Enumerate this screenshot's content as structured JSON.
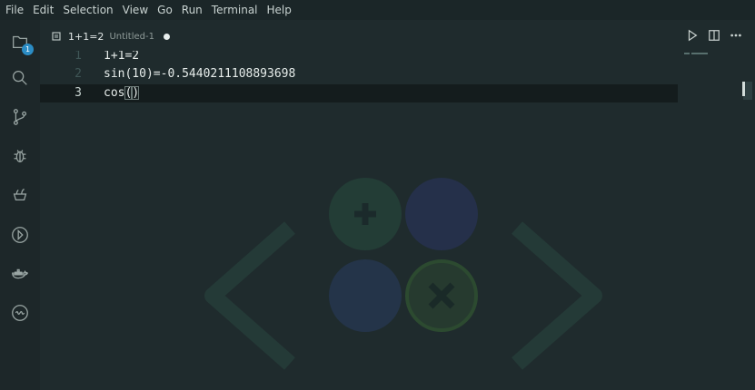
{
  "menu": [
    "File",
    "Edit",
    "Selection",
    "View",
    "Go",
    "Run",
    "Terminal",
    "Help"
  ],
  "activity": {
    "explorer_badge": "1",
    "icons": [
      "files-icon",
      "search-icon",
      "source-control-icon",
      "debug-icon",
      "extensions-icon",
      "timeline-icon",
      "docker-icon",
      "live-share-icon"
    ]
  },
  "tab": {
    "title": "1+1=2",
    "description": "Untitled-1",
    "dirty": true
  },
  "editor_actions": [
    "run-icon",
    "split-editor-icon",
    "more-actions-icon"
  ],
  "editor": {
    "lines": [
      {
        "number": "1",
        "text": "1+1=2"
      },
      {
        "number": "2",
        "text": "sin(10)=-0.5440211108893698"
      },
      {
        "number": "3",
        "text_prefix": "cos",
        "bracket_open": "(",
        "bracket_close": ")"
      }
    ],
    "current_line": 3
  },
  "colors": {
    "background": "#1f2b2d",
    "badge": "#2b8cc4",
    "current_line": "#141c1d"
  }
}
